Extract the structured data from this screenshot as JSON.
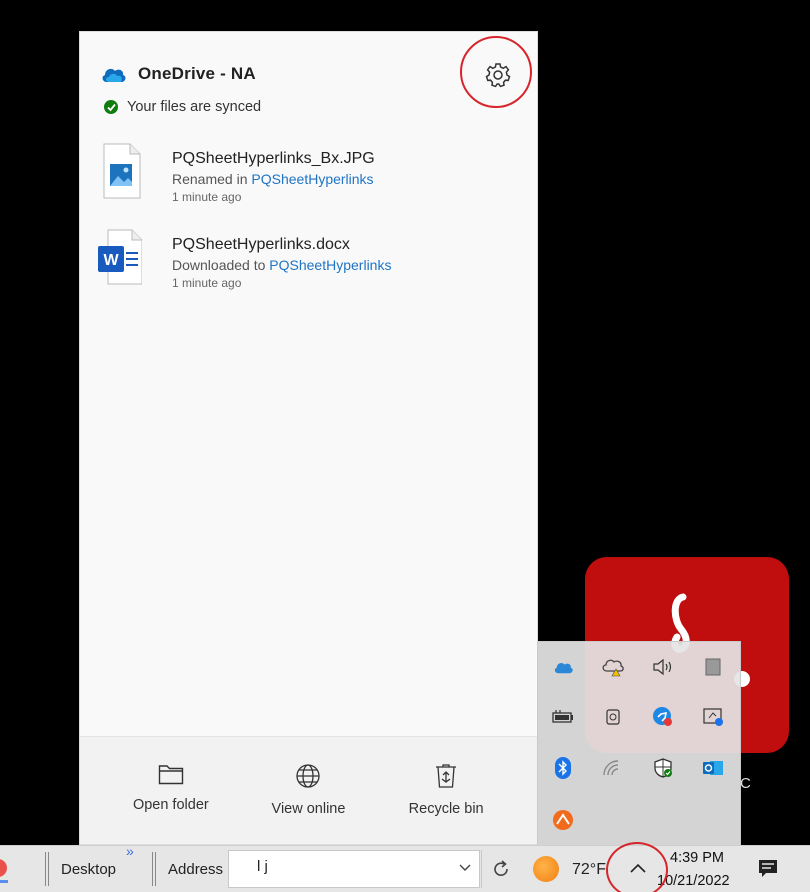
{
  "onedrive": {
    "title": "OneDrive - NA",
    "status": "Your files are synced",
    "files": [
      {
        "name": "PQSheetHyperlinks_Bx.JPG",
        "action_prefix": "Renamed in",
        "folder": "PQSheetHyperlinks",
        "time": "1 minute ago",
        "icon": "image-file-icon"
      },
      {
        "name": "PQSheetHyperlinks.docx",
        "action_prefix": "Downloaded to",
        "folder": "PQSheetHyperlinks",
        "time": "1 minute ago",
        "icon": "word-file-icon"
      }
    ],
    "footer": {
      "open_folder": "Open folder",
      "view_online": "View online",
      "recycle_bin": "Recycle bin"
    }
  },
  "desktop_icon": {
    "label_fragment": "C"
  },
  "tray_icons": [
    "onedrive-icon",
    "cloud-warning-icon",
    "volume-icon",
    "storage-icon",
    "battery-icon",
    "camera-icon",
    "app-badge-icon",
    "display-icon",
    "bluetooth-icon",
    "network-icon",
    "security-icon",
    "outlook-icon",
    "app-orange-icon"
  ],
  "taskbar": {
    "desktop_label": "Desktop",
    "chevron": "»",
    "address_label": "Address",
    "address_value": "l j",
    "temperature": "72°F",
    "time": "4:39 PM",
    "date": "10/21/2022"
  },
  "colors": {
    "annotation_red": "#d6252b",
    "link_blue": "#1f74c4",
    "sync_green": "#107c10",
    "app_red": "#c00d0d"
  }
}
